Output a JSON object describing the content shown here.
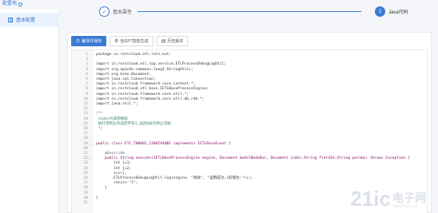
{
  "header": {
    "config_title": "配置项"
  },
  "sidebar": {
    "items": [
      {
        "label": "基本配置",
        "icon": "grid-icon"
      }
    ]
  },
  "steps": [
    {
      "index": "✓",
      "label": "基本属性",
      "state": "done"
    },
    {
      "index": "2",
      "label": "Java代码",
      "state": "active"
    }
  ],
  "toolbar": {
    "buttons": [
      {
        "label": "编译并保存",
        "icon": "save-icon",
        "active": true
      },
      {
        "label": "自GPT智能生成",
        "icon": "gear-icon",
        "active": false
      },
      {
        "label": "历史版本",
        "icon": "history-icon",
        "active": false
      }
    ]
  },
  "code": {
    "lines": [
      {
        "n": "1",
        "fold": "",
        "text": "package cn.restcloud.etl.rule.ext;",
        "cls": ""
      },
      {
        "n": "2",
        "fold": "",
        "text": "",
        "cls": ""
      },
      {
        "n": "3",
        "fold": "",
        "text": "import cn.restcloud.etl.log.service.ETLProcessDebugLogUtil;",
        "cls": ""
      },
      {
        "n": "4",
        "fold": "",
        "text": "import org.apache.commons.lang3.StringUtils;",
        "cls": ""
      },
      {
        "n": "5",
        "fold": "",
        "text": "import org.bson.Document;",
        "cls": ""
      },
      {
        "n": "6",
        "fold": "",
        "text": "import java.sql.Connection;",
        "cls": ""
      },
      {
        "n": "7",
        "fold": "",
        "text": "import cn.restcloud.framework.core.context.*;",
        "cls": ""
      },
      {
        "n": "8",
        "fold": "",
        "text": "import cn.restcloud.etl.base.IETLBaseProcessEngine;",
        "cls": ""
      },
      {
        "n": "9",
        "fold": "",
        "text": "import cn.restcloud.framework.core.util.*;",
        "cls": ""
      },
      {
        "n": "10",
        "fold": "",
        "text": "import cn.restcloud.framework.core.util.db.rdb.*;",
        "cls": ""
      },
      {
        "n": "11",
        "fold": "",
        "text": "import java.util.*;",
        "cls": ""
      },
      {
        "n": "12",
        "fold": "",
        "text": "",
        "cls": ""
      },
      {
        "n": "13",
        "fold": "",
        "text": "/**",
        "cls": "c-cm"
      },
      {
        "n": "14",
        "fold": "",
        "text": " indoc为请求数据",
        "cls": "c-cm"
      },
      {
        "n": "15",
        "fold": "",
        "text": " 执行得到业务返回字符1,返回0表示终止流程",
        "cls": "c-cm"
      },
      {
        "n": "16",
        "fold": "",
        "text": " */",
        "cls": "c-cm"
      },
      {
        "n": "17",
        "fold": "",
        "text": "",
        "cls": ""
      },
      {
        "n": "18",
        "fold": "",
        "text": "",
        "cls": ""
      },
      {
        "n": "19",
        "fold": "▾",
        "text": "public class ETL_T00001_120HIV4QB1 implements IETLBaseEvent {",
        "cls": "c-kw"
      },
      {
        "n": "20",
        "fold": "",
        "text": "",
        "cls": ""
      },
      {
        "n": "21",
        "fold": "",
        "text": "    @Override",
        "cls": "c-ann"
      },
      {
        "n": "22",
        "fold": "▾",
        "text": "    public String execute(IETLBaseProcessEngine engine, Document modelNodeDoc, Document indoc,String fieldId,String params) throws Exception {",
        "cls": "c-kw"
      },
      {
        "n": "23",
        "fold": "",
        "text": "        int i=1;",
        "cls": ""
      },
      {
        "n": "24",
        "fold": "",
        "text": "        int j=2;",
        "cls": ""
      },
      {
        "n": "25",
        "fold": "",
        "text": "        i=i+j;",
        "cls": ""
      },
      {
        "n": "26",
        "fold": "",
        "text": "        ETLProcessDebugLogUtil.log(engine, \"调试\", \"运用成功,i的值为:\"+i);",
        "cls": ""
      },
      {
        "n": "27",
        "fold": "",
        "text": "        return \"1\";",
        "cls": ""
      },
      {
        "n": "28",
        "fold": "",
        "text": "    }",
        "cls": ""
      },
      {
        "n": "29",
        "fold": "",
        "text": "",
        "cls": ""
      },
      {
        "n": "30",
        "fold": "",
        "text": "}",
        "cls": ""
      },
      {
        "n": "31",
        "fold": "",
        "text": "",
        "cls": ""
      }
    ]
  },
  "watermark": {
    "big": "21ic",
    "cn": "电子网",
    "url": "www.21ic.com"
  },
  "colors": {
    "accent": "#3a7bd5",
    "background": "#f4f6f9"
  }
}
